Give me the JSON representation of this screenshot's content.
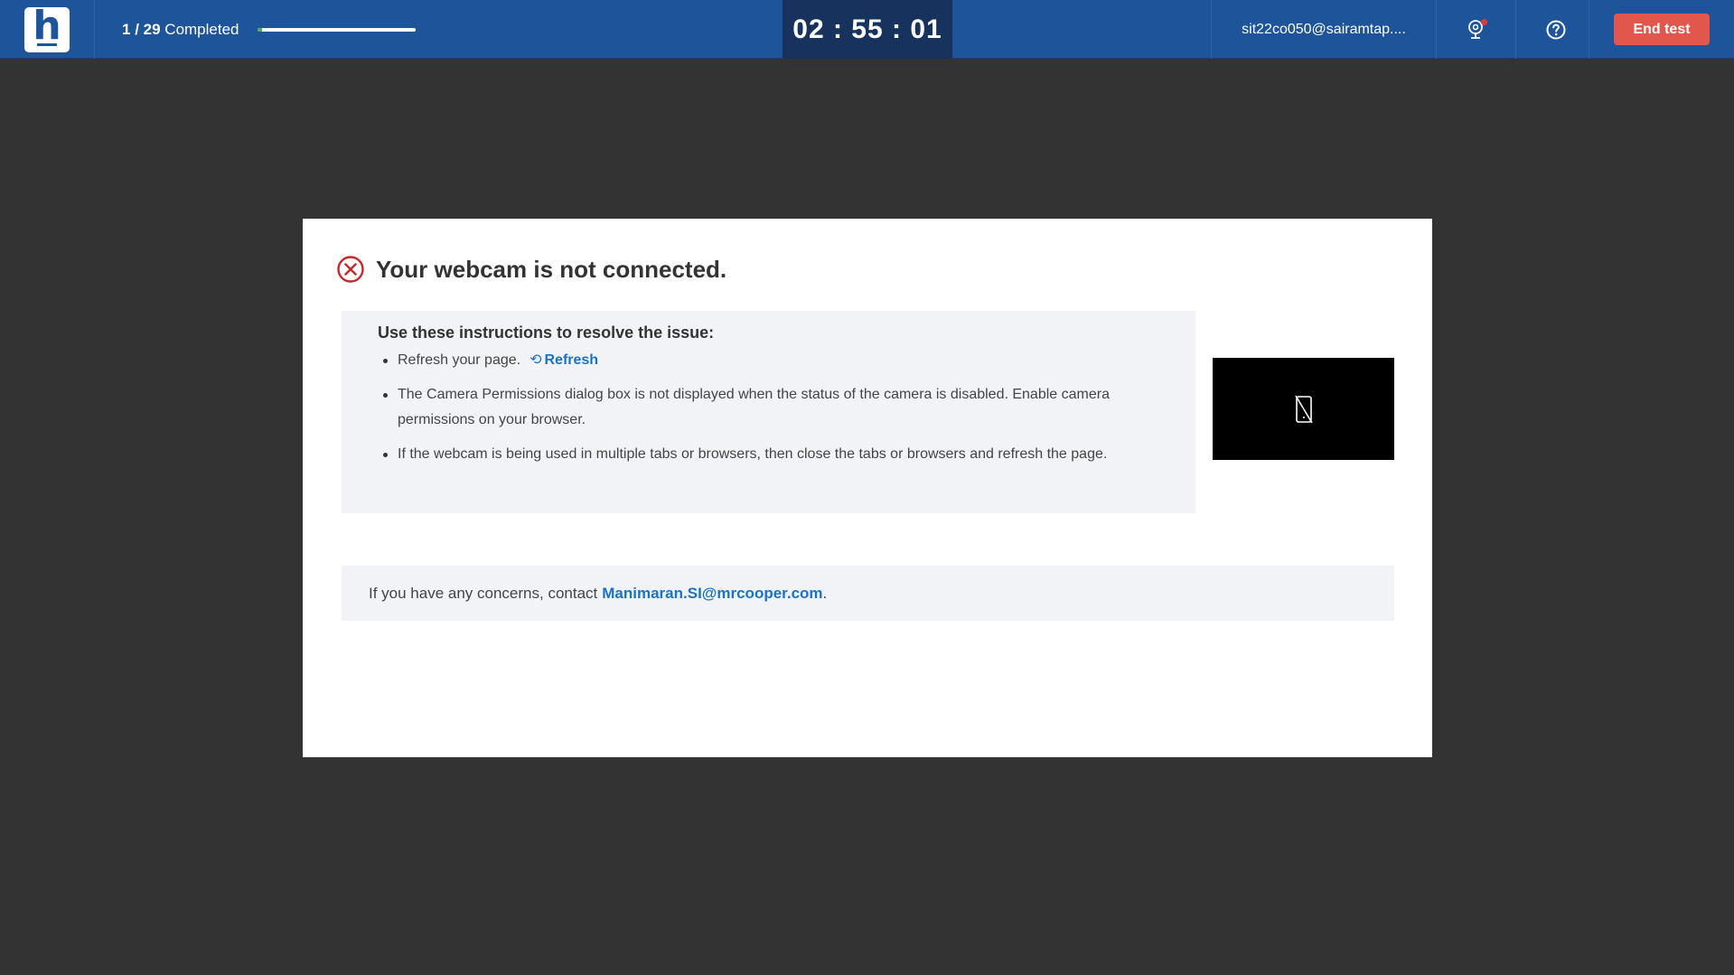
{
  "header": {
    "logo_letter": "h",
    "progress": {
      "current": "1",
      "separator": " / ",
      "total": "29",
      "label": " Completed",
      "fraction": 0.034
    },
    "timer": "02 : 55 : 01",
    "user_email": "sit22co050@sairamtap....",
    "webcam_icon": "webcam-icon",
    "help_icon": "help-icon",
    "end_test_label": "End test"
  },
  "dialog": {
    "title": "Your webcam is not connected.",
    "status_icon": "error-circle-x-icon",
    "instructions_heading": "Use these instructions to resolve the issue:",
    "instructions": [
      "Refresh your page.",
      "The Camera Permissions dialog box is not displayed when the status of the camera is disabled. Enable camera permissions on your browser.",
      "If the webcam is being used in multiple tabs or browsers, then close the tabs or browsers and refresh the page."
    ],
    "refresh_label": "Refresh",
    "concerns_text": "If you have any concerns, contact",
    "contact_email": "Manimaran.SI@mrcooper.com",
    "concerns_suffix": "."
  },
  "colors": {
    "header_bg": "#1e5499",
    "timer_bg": "#17335d",
    "end_button": "#e2574c",
    "error_red": "#c62828",
    "link_blue": "#1a73c7",
    "page_bg": "#333333"
  }
}
